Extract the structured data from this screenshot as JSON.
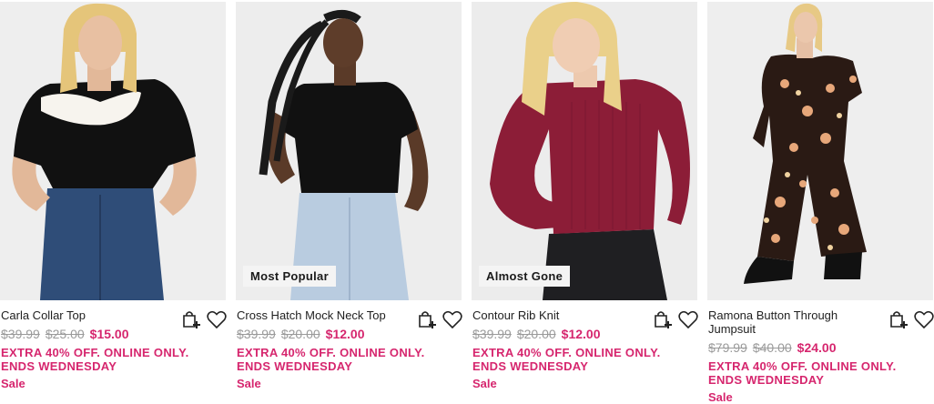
{
  "products": [
    {
      "name": "Carla Collar Top",
      "prices": [
        "$39.99",
        "$25.00"
      ],
      "current_price": "$15.00",
      "promo": "EXTRA 40% OFF. ONLINE ONLY. ENDS WEDNESDAY",
      "sale_label": "Sale",
      "badge": ""
    },
    {
      "name": "Cross Hatch Mock Neck Top",
      "prices": [
        "$39.99",
        "$20.00"
      ],
      "current_price": "$12.00",
      "promo": "EXTRA 40% OFF. ONLINE ONLY. ENDS WEDNESDAY",
      "sale_label": "Sale",
      "badge": "Most Popular"
    },
    {
      "name": "Contour Rib Knit",
      "prices": [
        "$39.99",
        "$20.00"
      ],
      "current_price": "$12.00",
      "promo": "EXTRA 40% OFF. ONLINE ONLY. ENDS WEDNESDAY",
      "sale_label": "Sale",
      "badge": "Almost Gone"
    },
    {
      "name": "Ramona Button Through Jumpsuit",
      "prices": [
        "$79.99",
        "$40.00"
      ],
      "current_price": "$24.00",
      "promo": "EXTRA 40% OFF. ONLINE ONLY. ENDS WEDNESDAY",
      "sale_label": "Sale",
      "badge": ""
    }
  ],
  "icons": {
    "bag": "add-to-bag-icon",
    "wishlist": "heart-icon"
  },
  "colors": {
    "sale_pink": "#d6266e",
    "strike_gray": "#9a9a9a"
  }
}
